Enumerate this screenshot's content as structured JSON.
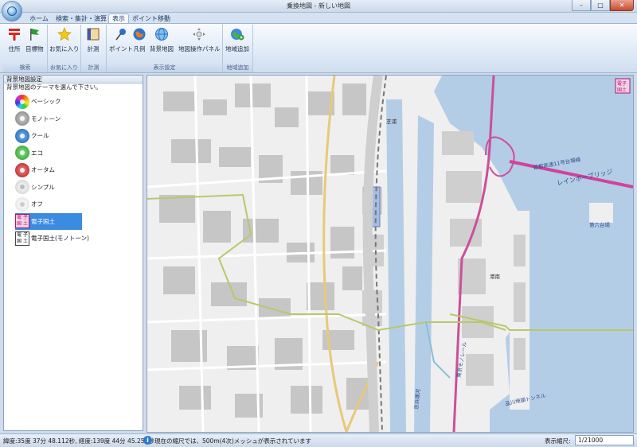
{
  "window": {
    "title": "乗換地図 - 新しい地図",
    "minimize": "–",
    "maximize": "□",
    "close": "✕"
  },
  "tabs": [
    "ホーム",
    "検索・集計・演算",
    "表示",
    "ポイント移動"
  ],
  "active_tab": "表示",
  "ribbon": {
    "groups": [
      {
        "label": "検索",
        "buttons": [
          "住所",
          "目標物"
        ]
      },
      {
        "label": "お気に入り",
        "buttons": [
          "お気に入り"
        ]
      },
      {
        "label": "計測",
        "buttons": [
          "計測"
        ]
      },
      {
        "label": "表示設定",
        "buttons": [
          "ポイント",
          "凡例",
          "背景地図",
          "地図操作パネル"
        ]
      },
      {
        "label": "地域追加",
        "buttons": [
          "地域追加"
        ]
      }
    ]
  },
  "sidebar": {
    "heading": "背景地図設定",
    "description": "背景地図のテーマを選んで下さい。",
    "selected": "電子国土",
    "themes": [
      {
        "label": "ベーシック",
        "color": "conic"
      },
      {
        "label": "モノトーン",
        "color": "#8c8c8c"
      },
      {
        "label": "クール",
        "color": "#1d6bc4"
      },
      {
        "label": "エコ",
        "color": "#2ea82e"
      },
      {
        "label": "オータム",
        "color": "#c42222"
      },
      {
        "label": "シンプル",
        "color": "#d8d8d8"
      },
      {
        "label": "オフ",
        "color": "#eaeaea"
      },
      {
        "label": "電子国土",
        "color": "kokudo-color"
      },
      {
        "label": "電子国土(モノトーン)",
        "color": "kokudo-mono"
      }
    ]
  },
  "map": {
    "corner_badge": "電子国土",
    "labels": {
      "rainbow_bridge": "レインボーブリッジ",
      "shuto_expressway": "首都高速11号台場線",
      "daiba": "第六台場",
      "tokyo_monorail": "東京モノレール",
      "shinagawa_tunnel": "品川埠頭トンネル",
      "kohnan": "港南",
      "keihin_canal": "京浜運河",
      "shibaura": "芝浦"
    },
    "colors": {
      "water": "#b4cde6",
      "land": "#efefef",
      "rail": "#cc4f9a",
      "boundary": "#b8c86a",
      "rainbow_bridge": "#d0439b"
    }
  },
  "status": {
    "coords": "緯度:35度 37分 48.112秒, 経度:139度 44分 45.256秒",
    "info_icon": "i",
    "message": "現在の縮尺では、500m(4次)メッシュが表示されています",
    "scale_label": "表示縮尺:",
    "scale_value": "1/21000"
  }
}
